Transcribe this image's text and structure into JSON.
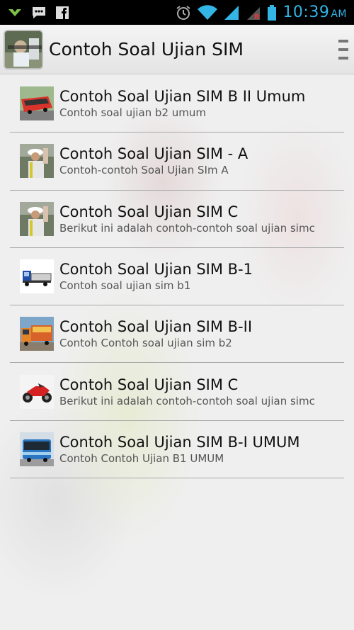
{
  "status_bar": {
    "time": "10:39",
    "ampm": "AM",
    "left_icons": [
      "download-icon",
      "bbm-icon",
      "facebook-icon"
    ],
    "right_icons": [
      "alarm-icon",
      "wifi-icon",
      "signal-icon",
      "signal-b-icon",
      "battery-icon"
    ]
  },
  "action_bar": {
    "title": "Contoh Soal Ujian SIM",
    "icon": "app-logo-icon"
  },
  "items": [
    {
      "title": "Contoh Soal Ujian SIM B II Umum",
      "subtitle": "Contoh soal ujian b2 umum",
      "thumb": "bus-icon"
    },
    {
      "title": "Contoh Soal Ujian SIM - A",
      "subtitle": "Contoh-contoh Soal Ujian SIm A",
      "thumb": "police-icon"
    },
    {
      "title": "Contoh Soal Ujian SIM C",
      "subtitle": "Berikut ini adalah contoh-contoh soal ujian simc",
      "thumb": "police-icon"
    },
    {
      "title": "Contoh Soal Ujian SIM B-1",
      "subtitle": "Contoh soal ujian sim b1",
      "thumb": "truck-icon"
    },
    {
      "title": "Contoh Soal Ujian SIM B-II",
      "subtitle": "Contoh Contoh soal ujian sim b2",
      "thumb": "big-truck-icon"
    },
    {
      "title": "Contoh Soal Ujian SIM C",
      "subtitle": "Berikut ini adalah contoh-contoh soal ujian simc",
      "thumb": "motorcycle-icon"
    },
    {
      "title": "Contoh Soal Ujian SIM B-I UMUM",
      "subtitle": "Contoh Contoh Ujian B1 UMUM",
      "thumb": "minibus-icon"
    }
  ],
  "colors": {
    "status_accent": "#33b5e5",
    "divider": "#a9a9a9"
  }
}
